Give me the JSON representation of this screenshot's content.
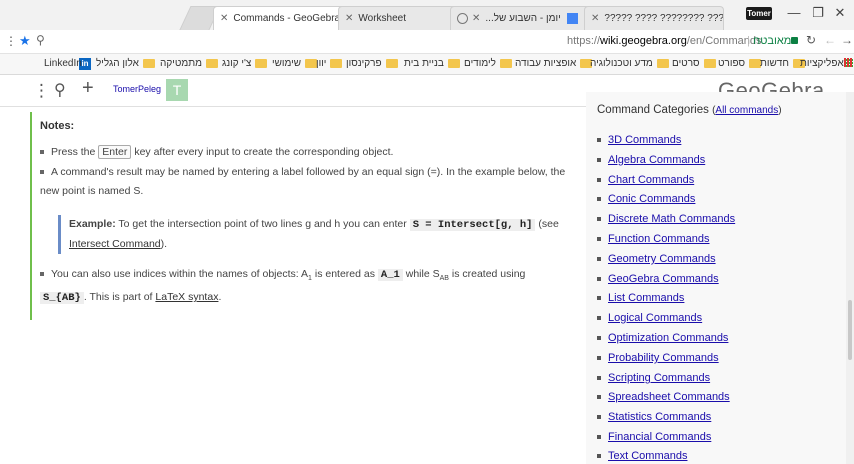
{
  "tabs": [
    {
      "title": "Commands - GeoGebra"
    },
    {
      "title": "Worksheet"
    },
    {
      "title": "יומן - השבוע של..."
    },
    {
      "title": "?????  ???? ????????  ??? |"
    }
  ],
  "profile_label": "Tomer",
  "address": {
    "prefix": "https://",
    "host": "wiki.geogebra.org",
    "path": "/en/Commands",
    "secure_label": "מאובטח"
  },
  "bookmarks": [
    "אפליקציות",
    "חדשות",
    "ספורט",
    "סרטים",
    "מדע וטכנולוגיה",
    "אופציות עבודה",
    "לימודים",
    "בניית בית",
    "פרקינסון",
    "יוון",
    "שימושי",
    "צ'י קונג",
    "מתמטיקה",
    "אלון הגליל",
    "LinkedIn"
  ],
  "geogebra": {
    "username": "TomerPeleg",
    "avatar_letter": "T",
    "logo": "GeoGebra"
  },
  "notes": {
    "title": "Notes:",
    "item1_pre": "Press the",
    "item1_key": "Enter",
    "item1_post": "key after every input to create the corresponding object.",
    "item2": "A command's result may be named by entering a label followed by an equal sign (=). In the example below, the new point is named S.",
    "example_label": "Example:",
    "example_text": "To get the intersection point of two lines g and h you can enter",
    "example_code": "S = Intersect[g, h]",
    "example_see": "(see",
    "example_link": "Intersect Command",
    "example_end": ").",
    "item3_pre": "You can also use indices within the names of objects: A",
    "item3_sub1": "1",
    "item3_mid": "is entered as",
    "item3_code1": "A_1",
    "item3_mid2": "while S",
    "item3_sub2": "AB",
    "item3_mid3": "is created using",
    "item3_code2": "S_{AB}",
    "item3_post": ". This is part of",
    "item3_link": "LaTeX syntax",
    "item3_end": "."
  },
  "sidebar": {
    "title": "Command Categories",
    "all_link": "All commands",
    "commands": [
      "3D Commands",
      "Algebra Commands",
      "Chart Commands",
      "Conic Commands",
      "Discrete Math Commands",
      "Function Commands",
      "Geometry Commands",
      "GeoGebra Commands",
      "List Commands",
      "Logical Commands",
      "Optimization Commands",
      "Probability Commands",
      "Scripting Commands",
      "Spreadsheet Commands",
      "Statistics Commands",
      "Financial Commands",
      "Text Commands"
    ]
  }
}
